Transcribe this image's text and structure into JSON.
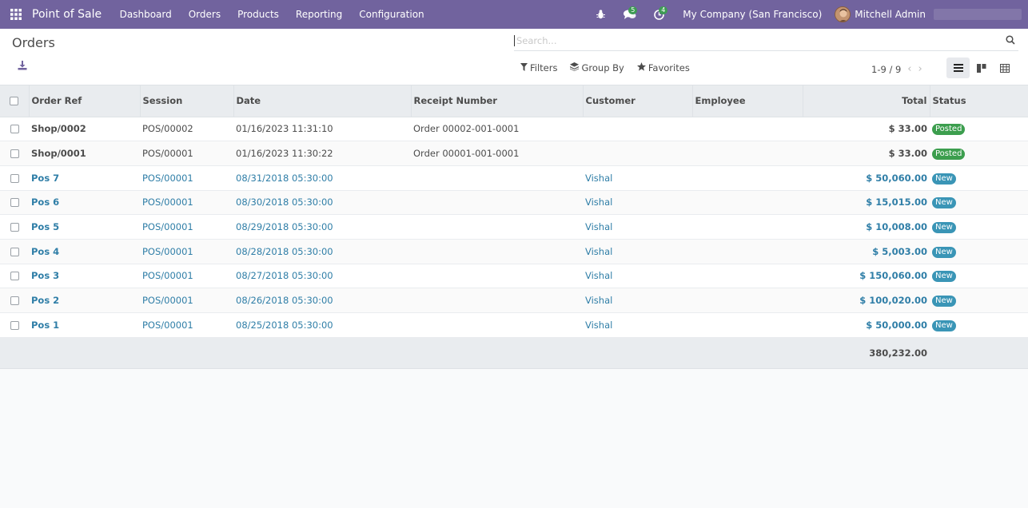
{
  "navbar": {
    "app_title": "Point of Sale",
    "menu": [
      "Dashboard",
      "Orders",
      "Products",
      "Reporting",
      "Configuration"
    ],
    "messages_count": "5",
    "activities_count": "4",
    "company": "My Company (San Francisco)",
    "user": "Mitchell Admin"
  },
  "control_panel": {
    "breadcrumb": "Orders",
    "search_placeholder": "Search...",
    "filters_label": "Filters",
    "group_by_label": "Group By",
    "favorites_label": "Favorites",
    "pager": "1-9 / 9"
  },
  "table": {
    "columns": {
      "order_ref": "Order Ref",
      "session": "Session",
      "date": "Date",
      "receipt": "Receipt Number",
      "customer": "Customer",
      "employee": "Employee",
      "total": "Total",
      "status": "Status"
    },
    "rows": [
      {
        "ref": "Shop/0002",
        "session": "POS/00002",
        "date": "01/16/2023 11:31:10",
        "receipt": "Order 00002-001-0001",
        "customer": "",
        "employee": "",
        "total": "$ 33.00",
        "status": "Posted"
      },
      {
        "ref": "Shop/0001",
        "session": "POS/00001",
        "date": "01/16/2023 11:30:22",
        "receipt": "Order 00001-001-0001",
        "customer": "",
        "employee": "",
        "total": "$ 33.00",
        "status": "Posted"
      },
      {
        "ref": "Pos 7",
        "session": "POS/00001",
        "date": "08/31/2018 05:30:00",
        "receipt": "",
        "customer": "Vishal",
        "employee": "",
        "total": "$ 50,060.00",
        "status": "New"
      },
      {
        "ref": "Pos 6",
        "session": "POS/00001",
        "date": "08/30/2018 05:30:00",
        "receipt": "",
        "customer": "Vishal",
        "employee": "",
        "total": "$ 15,015.00",
        "status": "New"
      },
      {
        "ref": "Pos 5",
        "session": "POS/00001",
        "date": "08/29/2018 05:30:00",
        "receipt": "",
        "customer": "Vishal",
        "employee": "",
        "total": "$ 10,008.00",
        "status": "New"
      },
      {
        "ref": "Pos 4",
        "session": "POS/00001",
        "date": "08/28/2018 05:30:00",
        "receipt": "",
        "customer": "Vishal",
        "employee": "",
        "total": "$ 5,003.00",
        "status": "New"
      },
      {
        "ref": "Pos 3",
        "session": "POS/00001",
        "date": "08/27/2018 05:30:00",
        "receipt": "",
        "customer": "Vishal",
        "employee": "",
        "total": "$ 150,060.00",
        "status": "New"
      },
      {
        "ref": "Pos 2",
        "session": "POS/00001",
        "date": "08/26/2018 05:30:00",
        "receipt": "",
        "customer": "Vishal",
        "employee": "",
        "total": "$ 100,020.00",
        "status": "New"
      },
      {
        "ref": "Pos 1",
        "session": "POS/00001",
        "date": "08/25/2018 05:30:00",
        "receipt": "",
        "customer": "Vishal",
        "employee": "",
        "total": "$ 50,000.00",
        "status": "New"
      }
    ],
    "grand_total": "380,232.00"
  },
  "colors": {
    "navbar": "#71639e",
    "posted_badge": "#3c9e4e",
    "new_badge": "#3a95b6",
    "link_text": "#2f7ea7"
  },
  "icons": {
    "apps": "grid-icon",
    "debug": "bug-icon",
    "messages": "chat-icon",
    "activities": "clock-icon",
    "download": "download-icon",
    "search": "search-icon",
    "filters": "filter-icon",
    "group_by": "layers-icon",
    "favorites": "star-icon",
    "list_view": "list-icon",
    "kanban_view": "kanban-icon",
    "pivot_view": "table-icon"
  }
}
